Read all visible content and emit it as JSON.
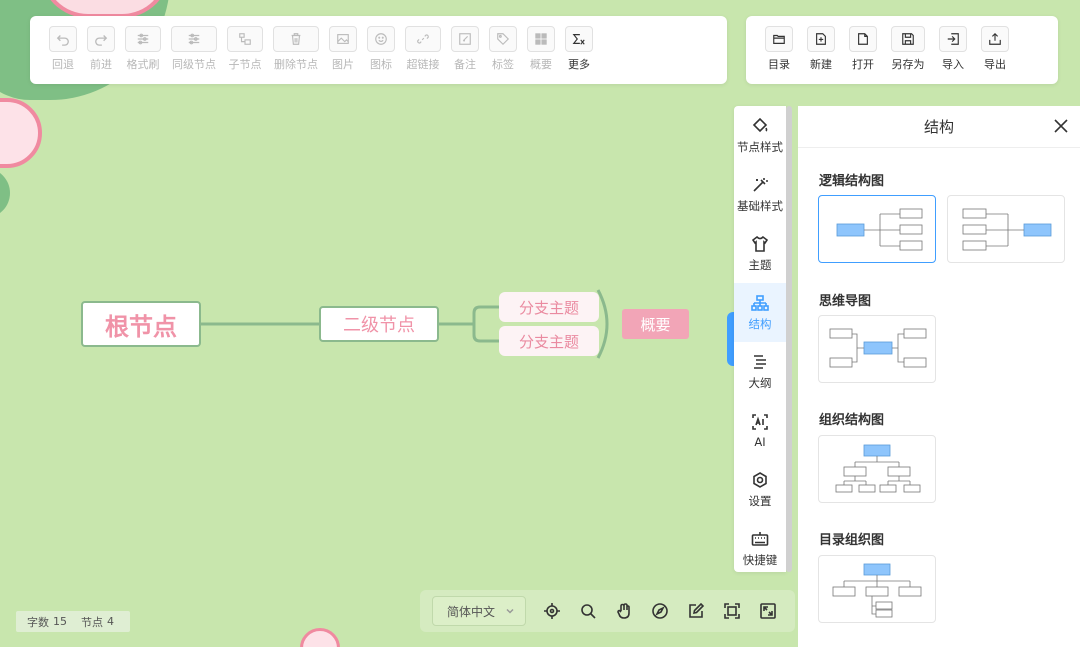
{
  "toolbar_left": [
    {
      "label": "回退",
      "icon": "undo-icon",
      "enabled": false
    },
    {
      "label": "前进",
      "icon": "redo-icon",
      "enabled": false
    },
    {
      "label": "格式刷",
      "icon": "format-painter-icon",
      "enabled": false
    },
    {
      "label": "同级节点",
      "icon": "sibling-node-icon",
      "enabled": false
    },
    {
      "label": "子节点",
      "icon": "child-node-icon",
      "enabled": false
    },
    {
      "label": "删除节点",
      "icon": "trash-icon",
      "enabled": false
    },
    {
      "label": "图片",
      "icon": "image-icon",
      "enabled": false
    },
    {
      "label": "图标",
      "icon": "smiley-icon",
      "enabled": false
    },
    {
      "label": "超链接",
      "icon": "link-icon",
      "enabled": false
    },
    {
      "label": "备注",
      "icon": "note-icon",
      "enabled": false
    },
    {
      "label": "标签",
      "icon": "tag-icon",
      "enabled": false
    },
    {
      "label": "概要",
      "icon": "summary-icon",
      "enabled": false
    },
    {
      "label": "更多",
      "icon": "formula-icon",
      "enabled": true
    }
  ],
  "toolbar_right": [
    {
      "label": "目录",
      "icon": "folder-icon"
    },
    {
      "label": "新建",
      "icon": "new-file-icon"
    },
    {
      "label": "打开",
      "icon": "open-file-icon"
    },
    {
      "label": "另存为",
      "icon": "save-as-icon"
    },
    {
      "label": "导入",
      "icon": "import-icon"
    },
    {
      "label": "导出",
      "icon": "export-icon"
    }
  ],
  "mindmap": {
    "root": "根节点",
    "second": "二级节点",
    "branches": [
      "分支主题",
      "分支主题"
    ],
    "summary": "概要"
  },
  "side_nav": [
    {
      "label": "节点样式",
      "icon": "paint-bucket-icon",
      "active": false
    },
    {
      "label": "基础样式",
      "icon": "magic-wand-icon",
      "active": false
    },
    {
      "label": "主题",
      "icon": "shirt-icon",
      "active": false
    },
    {
      "label": "结构",
      "icon": "structure-icon",
      "active": true
    },
    {
      "label": "大纲",
      "icon": "outline-icon",
      "active": false
    },
    {
      "label": "AI",
      "icon": "ai-icon",
      "active": false
    },
    {
      "label": "设置",
      "icon": "settings-icon",
      "active": false
    },
    {
      "label": "快捷键",
      "icon": "keyboard-icon",
      "active": false
    }
  ],
  "panel": {
    "title": "结构",
    "groups": [
      "逻辑结构图",
      "思维导图",
      "组织结构图",
      "目录组织图"
    ]
  },
  "bottom": {
    "language": "简体中文",
    "icons": [
      "locate-icon",
      "search-icon",
      "mouse-icon",
      "compass-icon",
      "edit-icon",
      "fit-screen-icon",
      "fullscreen-icon"
    ]
  },
  "counts": {
    "word_label": "字数",
    "word_value": "15",
    "node_label": "节点",
    "node_value": "4"
  },
  "colors": {
    "background": "#c8e6ad",
    "accent": "#409eff",
    "node_text": "#f093a8",
    "summary_bg": "#f2a5b7",
    "line": "#8bb98d"
  }
}
